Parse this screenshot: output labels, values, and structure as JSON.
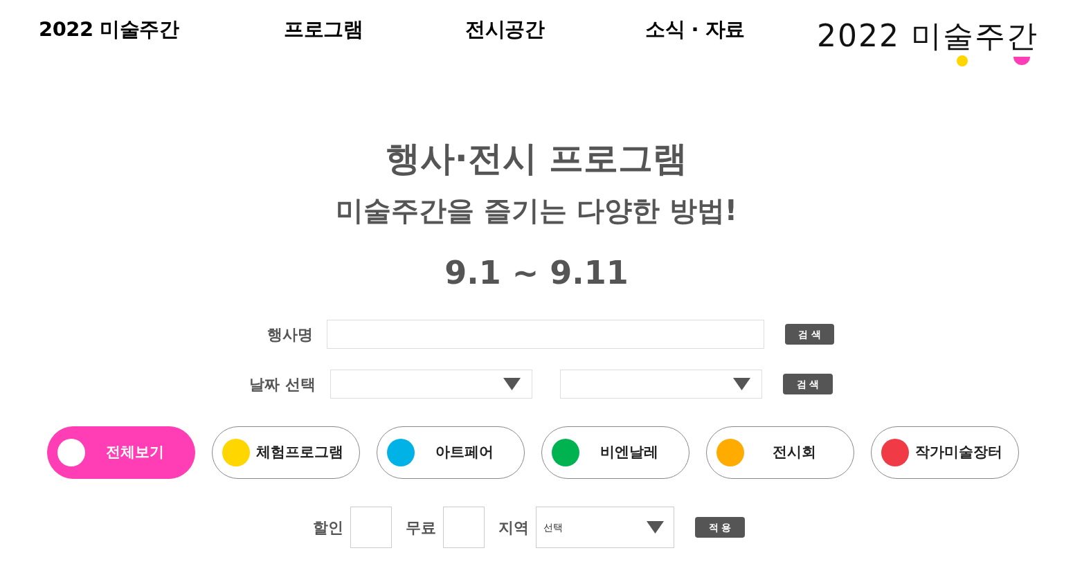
{
  "nav": {
    "items": [
      {
        "label": "2022 미술주간"
      },
      {
        "label": "프로그램"
      },
      {
        "label": "전시공간"
      },
      {
        "label": "소식 · 자료"
      }
    ]
  },
  "logo": {
    "text": "2022 미술주간"
  },
  "heading": {
    "title": "행사·전시 프로그램",
    "subtitle": "미술주간을 즐기는 다양한 방법!",
    "dates": "9.1 ~ 9.11"
  },
  "search": {
    "name_label": "행사명",
    "name_button": "검 색",
    "date_label": "날짜 선택",
    "date_button": "검 색"
  },
  "categories": [
    {
      "label": "전체보기",
      "color": "#ffffff",
      "selected": true
    },
    {
      "label": "체험프로그램",
      "color": "#ffd600",
      "selected": false
    },
    {
      "label": "아트페어",
      "color": "#00b2e5",
      "selected": false
    },
    {
      "label": "비엔날레",
      "color": "#00b350",
      "selected": false
    },
    {
      "label": "전시회",
      "color": "#ffab00",
      "selected": false
    },
    {
      "label": "작가미술장터",
      "color": "#f03a45",
      "selected": false
    }
  ],
  "filters": {
    "discount": {
      "label": "할인",
      "checked": false
    },
    "free": {
      "label": "무료",
      "checked": false
    },
    "region": {
      "label": "지역",
      "value": "선택"
    },
    "apply_button": "적 용"
  }
}
